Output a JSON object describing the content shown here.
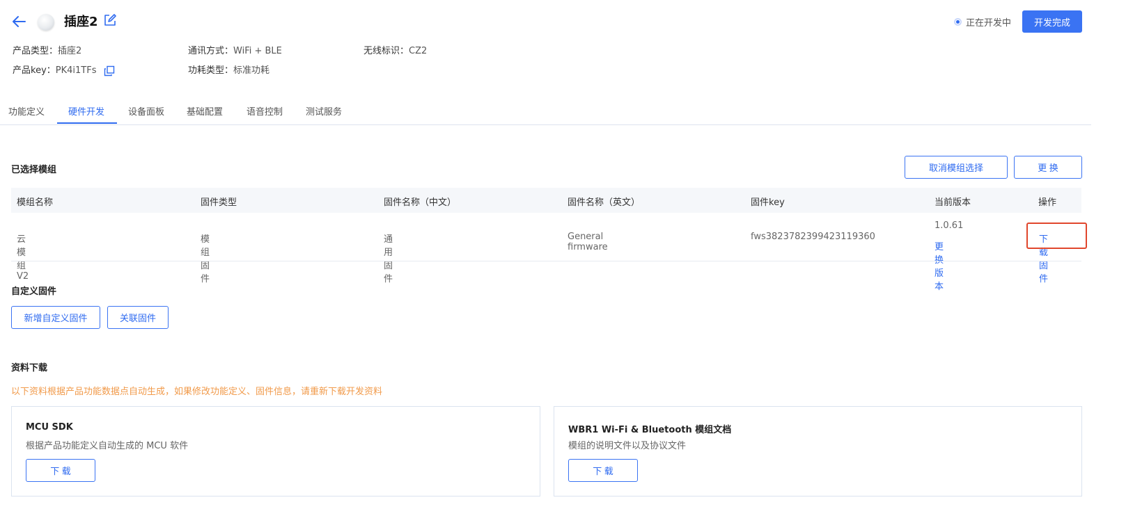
{
  "header": {
    "title": "插座2",
    "status_text": "正在开发中",
    "finish_label": "开发完成"
  },
  "info": {
    "product_type_label": "产品类型：",
    "product_type_value": "插座2",
    "comm_label": "通讯方式：",
    "comm_value": "WiFi + BLE",
    "wireless_label": "无线标识：",
    "wireless_value": "CZ2",
    "product_key_label": "产品key：",
    "product_key_value": "PK4i1TFs",
    "power_label": "功耗类型：",
    "power_value": "标准功耗"
  },
  "tabs": [
    {
      "label": "功能定义"
    },
    {
      "label": "硬件开发"
    },
    {
      "label": "设备面板"
    },
    {
      "label": "基础配置"
    },
    {
      "label": "语音控制"
    },
    {
      "label": "测试服务"
    }
  ],
  "selected_module": {
    "title": "已选择模组",
    "cancel_label": "取消模组选择",
    "replace_label": "更 换",
    "columns": [
      "模组名称",
      "固件类型",
      "固件名称（中文）",
      "固件名称（英文）",
      "固件key",
      "当前版本",
      "操作"
    ],
    "row": {
      "module_name": "云模组V2",
      "firmware_type": "模组固件",
      "name_cn": "通用固件",
      "name_en": "General firmware",
      "firmware_key": "fws3823782399423119360",
      "version": "1.0.61",
      "change_version": "更换版本",
      "download": "下载固件"
    }
  },
  "custom_firmware": {
    "title": "自定义固件",
    "add_label": "新增自定义固件",
    "link_label": "关联固件"
  },
  "downloads": {
    "title": "资料下载",
    "warning": "以下资料根据产品功能数据点自动生成，如果修改功能定义、固件信息，请重新下载开发资料",
    "cards": [
      {
        "title": "MCU SDK",
        "desc": "根据产品功能定义自动生成的 MCU 软件",
        "button": "下 载"
      },
      {
        "title": "WBR1 Wi-Fi & Bluetooth 模组文档",
        "desc": "模组的说明文件以及协议文件",
        "button": "下 载"
      }
    ]
  },
  "colors": {
    "accent": "#2f6bf0",
    "warning": "#f19a4a",
    "highlight": "#e0462c"
  }
}
